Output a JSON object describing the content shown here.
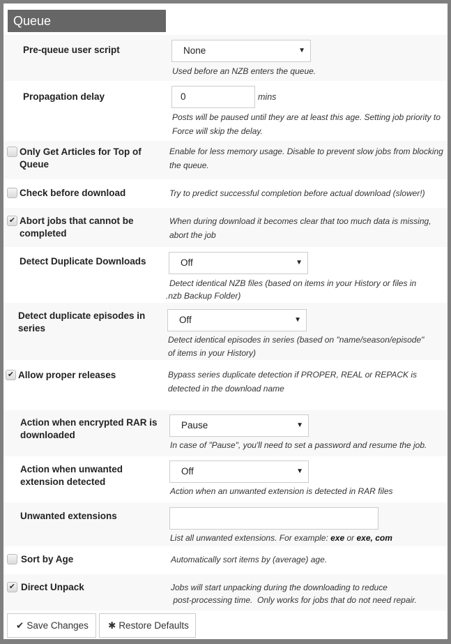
{
  "section": {
    "title": "Queue"
  },
  "settings": {
    "pre_queue_script": {
      "label": "Pre-queue user script",
      "value": "None",
      "description": "Used before an NZB enters the queue."
    },
    "propagation_delay": {
      "label": "Propagation delay",
      "value": "0",
      "unit": "mins",
      "description_line1": "Posts will be paused until they are at least this age. Setting job priority to",
      "description_line2": "Force will skip the delay."
    },
    "top_only": {
      "label_line1": "Only Get Articles for Top of",
      "label_line2": "Queue",
      "checked": false,
      "description_line1": "Enable for less memory usage. Disable to prevent slow jobs from blocking",
      "description_line2": "the queue."
    },
    "pre_check": {
      "label": "Check before download",
      "checked": false,
      "description": "Try to predict successful completion before actual download (slower!)"
    },
    "fail_hopeless": {
      "label_line1": "Abort jobs that cannot be",
      "label_line2": "completed",
      "checked": true,
      "description_line1": "When during download it becomes clear that too much data is missing,",
      "description_line2": "abort the job"
    },
    "no_dupes": {
      "label": "Detect Duplicate Downloads",
      "value": "Off",
      "description_line1": "Detect identical NZB files (based on items in your History or files in",
      "description_line2": ".nzb Backup Folder)"
    },
    "no_series_dupes": {
      "label_line1": "Detect duplicate episodes in",
      "label_line2": "series",
      "value": "Off",
      "description_line1": "Detect identical episodes in series (based on \"name/season/episode\"",
      "description_line2": "of items in your History)"
    },
    "allow_proper": {
      "label": "Allow proper releases",
      "checked": true,
      "description_line1": "Bypass series duplicate detection if PROPER, REAL or REPACK is",
      "description_line2": "detected in the download name"
    },
    "pause_on_pwrar": {
      "label_line1": "Action when encrypted RAR is",
      "label_line2": "downloaded",
      "value": "Pause",
      "description": "In case of \"Pause\", you'll need to set a password and resume the job."
    },
    "action_on_unwanted": {
      "label_line1": "Action when unwanted",
      "label_line2": "extension detected",
      "value": "Off",
      "description": "Action when an unwanted extension is detected in RAR files"
    },
    "unwanted_extensions": {
      "label": "Unwanted extensions",
      "value": "",
      "description_prefix": "List all unwanted extensions. For example: ",
      "example1": "exe",
      "or": " or ",
      "example2": "exe, com"
    },
    "auto_sort": {
      "label": "Sort by Age",
      "checked": false,
      "description": "Automatically sort items by (average) age."
    },
    "direct_unpack": {
      "label": "Direct Unpack",
      "checked": true,
      "description_line1": "Jobs will start unpacking during the downloading to reduce",
      "description_line2": " post-processing time.  Only works for jobs that do not need repair."
    }
  },
  "icons": {
    "check": "✔",
    "caret": "▼",
    "asterisk": "✱"
  },
  "buttons": {
    "save": "Save Changes",
    "restore": "Restore Defaults"
  }
}
